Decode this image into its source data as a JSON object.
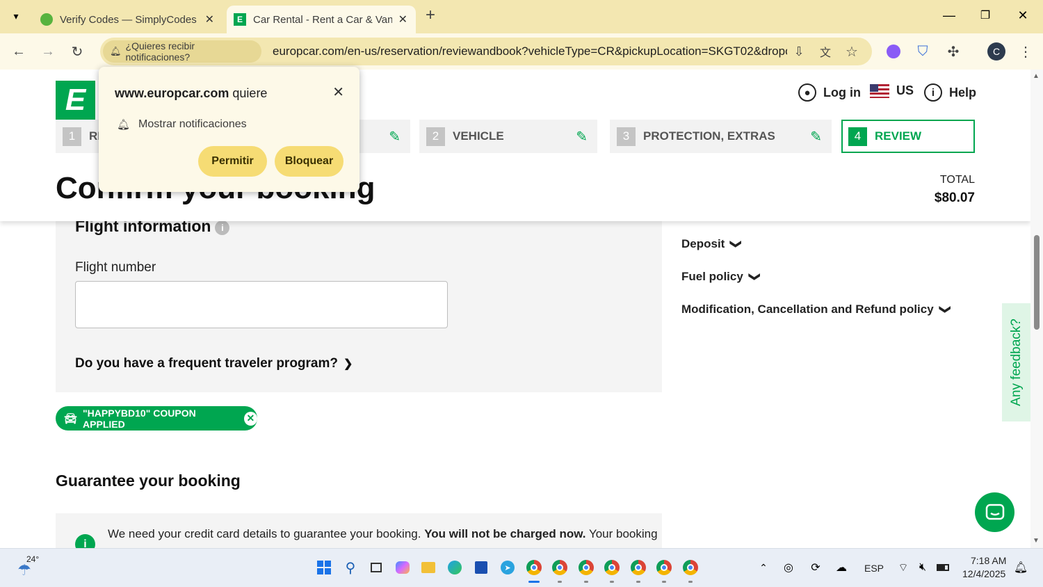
{
  "browser": {
    "tabs": [
      {
        "title": "Verify Codes — SimplyCodes"
      },
      {
        "title": "Car Rental - Rent a Car & Van W"
      }
    ],
    "notif_chip": "¿Quieres recibir notificaciones?",
    "url": "europcar.com/en-us/reservation/reviewandbook?vehicleType=CR&pickupLocation=SKGT02&dropo...",
    "profile_initial": "C"
  },
  "popup": {
    "site": "www.europcar.com",
    "wants": "quiere",
    "row": "Mostrar notificaciones",
    "allow": "Permitir",
    "block": "Bloquear"
  },
  "header": {
    "logo": "E",
    "login": "Log in",
    "country": "US",
    "help": "Help",
    "steps": [
      {
        "num": "1",
        "label": "RI"
      },
      {
        "num": "2",
        "label": "VEHICLE"
      },
      {
        "num": "3",
        "label": "PROTECTION, EXTRAS"
      },
      {
        "num": "4",
        "label": "REVIEW"
      }
    ],
    "title": "Confirm your booking",
    "total_label": "TOTAL",
    "total_value": "$80.07"
  },
  "flight": {
    "title": "Flight information",
    "number_label": "Flight number",
    "number_value": "",
    "frequent": "Do you have a frequent traveler program?"
  },
  "coupon": "\"HAPPYBD10\" COUPON APPLIED",
  "guarantee": {
    "title": "Guarantee your booking",
    "text_a": "We need your credit card details to guarantee your booking. ",
    "text_b": "You will not be charged now.",
    "text_c": " Your booking"
  },
  "policies": [
    "Deposit",
    "Fuel policy",
    "Modification, Cancellation and Refund policy"
  ],
  "feedback": "Any feedback?",
  "taskbar": {
    "weather": "24°",
    "lang": "ESP",
    "time": "7:18 AM",
    "date": "12/4/2025"
  },
  "colors": {
    "brand": "#00a650",
    "chrome_bar": "#f3e7b1",
    "popup_button": "#f6dc74"
  }
}
